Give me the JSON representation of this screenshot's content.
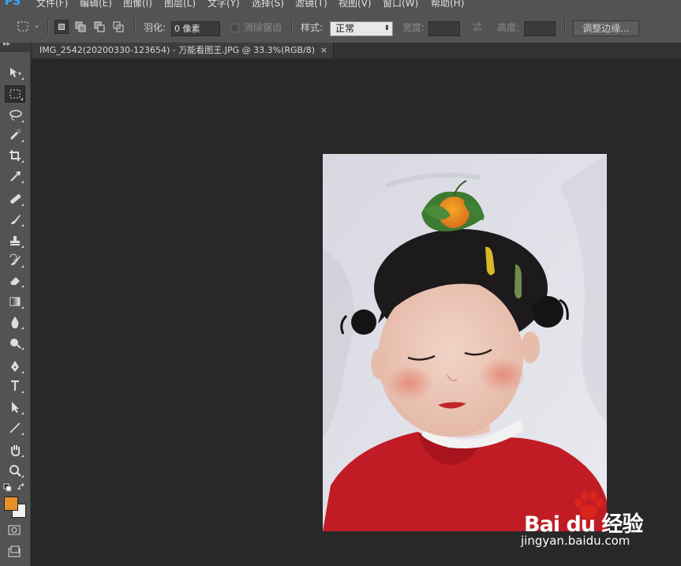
{
  "app": {
    "logo": "PS"
  },
  "menubar": {
    "items": [
      "文件(F)",
      "编辑(E)",
      "图像(I)",
      "图层(L)",
      "文字(Y)",
      "选择(S)",
      "滤镜(T)",
      "视图(V)",
      "窗口(W)",
      "帮助(H)"
    ]
  },
  "options": {
    "feather_label": "羽化:",
    "feather_value": "0 像素",
    "antialias_label": "消除锯齿",
    "style_label": "样式:",
    "style_value": "正常",
    "width_label": "宽度:",
    "height_label": "高度:",
    "refine_edge_label": "调整边缘..."
  },
  "document": {
    "tab_title": "IMG_2542(20200330-123654) - 万能看图王.JPG @ 33.3%(RGB/8)",
    "close_glyph": "×"
  },
  "colors": {
    "foreground": "#e8902a",
    "background": "#f0f0f0",
    "accent": "#31a8ff"
  },
  "toolbox": {
    "tools": [
      "move-tool",
      "marquee-tool",
      "lasso-tool",
      "quick-selection-tool",
      "crop-tool",
      "eyedropper-tool",
      "healing-brush-tool",
      "brush-tool",
      "clone-stamp-tool",
      "history-brush-tool",
      "eraser-tool",
      "gradient-tool",
      "blur-tool",
      "dodge-tool",
      "pen-tool",
      "type-tool",
      "path-selection-tool",
      "line-tool",
      "hand-tool",
      "zoom-tool"
    ],
    "active_tool": "marquee-tool"
  },
  "watermark": {
    "brand": "Bai du 经验",
    "url": "jingyan.baidu.com"
  }
}
